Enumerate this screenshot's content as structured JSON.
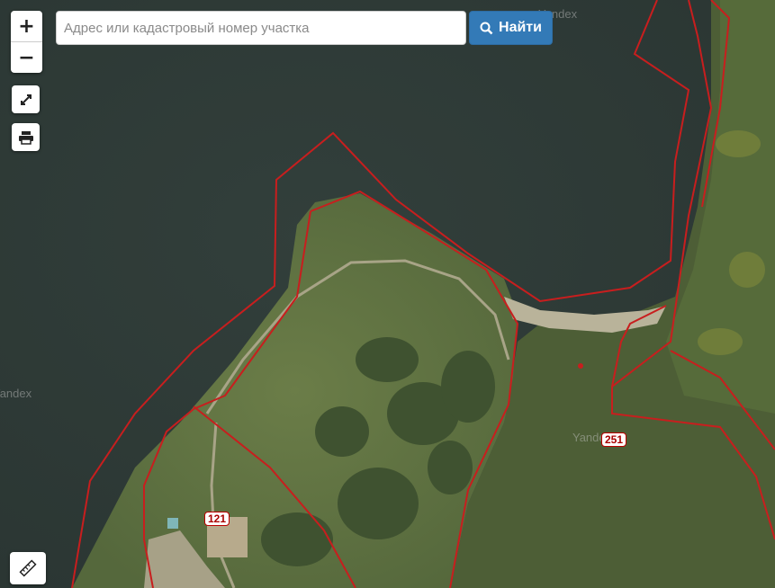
{
  "search": {
    "placeholder": "Адрес или кадастровый номер участка",
    "value": "",
    "button_label": "Найти"
  },
  "zoom": {
    "in_label": "+",
    "out_label": "−"
  },
  "map_labels": {
    "parcel_a": "121",
    "parcel_b": "251"
  },
  "watermarks": {
    "top": "Yandex",
    "left": "Yandex",
    "center": "Yandex"
  },
  "colors": {
    "boundary": "#c81e1e",
    "water": "#2f3a37",
    "button": "#337ab7"
  },
  "icons": [
    "fullscreen-icon",
    "print-icon",
    "ruler-icon",
    "search-icon"
  ]
}
